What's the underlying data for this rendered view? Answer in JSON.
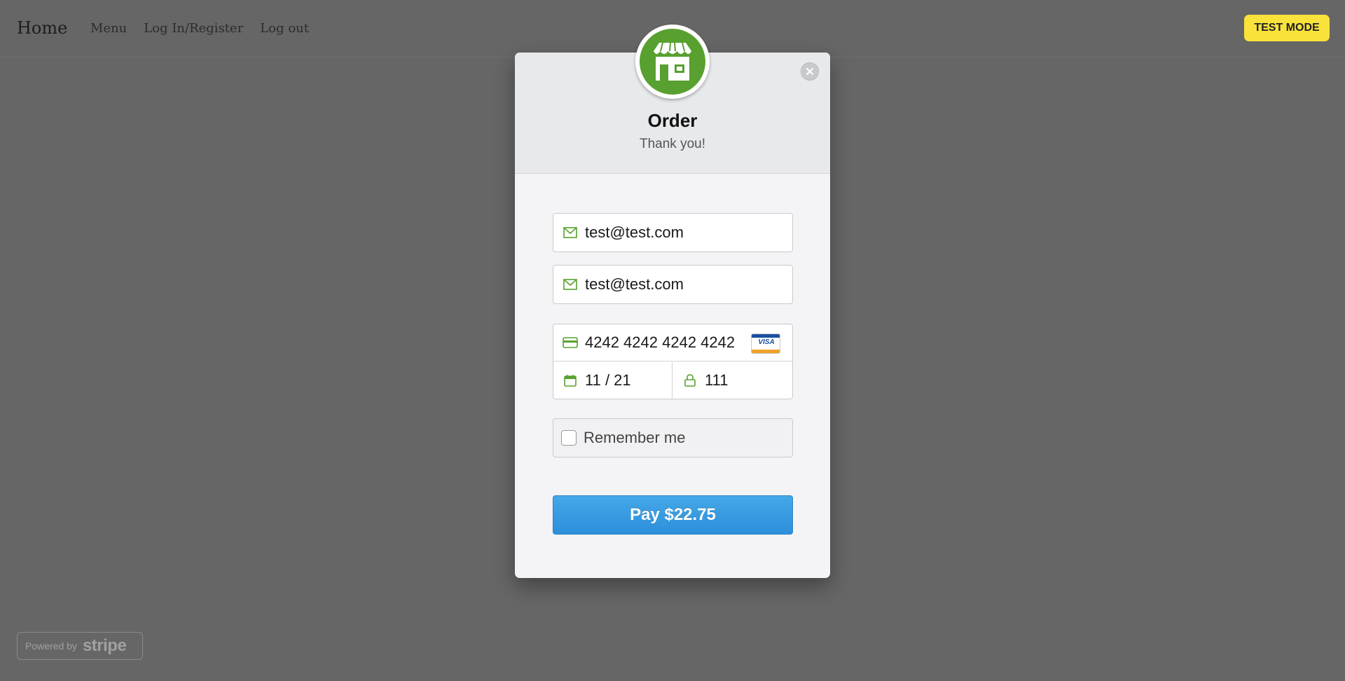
{
  "nav": {
    "home": "Home",
    "links": [
      "Menu",
      "Log In/Register",
      "Log out"
    ],
    "badge": "TEST MODE"
  },
  "modal": {
    "logo_icon": "storefront-icon",
    "title": "Order",
    "subtitle": "Thank you!",
    "email_1": "test@test.com",
    "email_2": "test@test.com",
    "card_number": "4242 4242 4242 4242",
    "card_brand": "VISA",
    "expiry": "11 / 21",
    "cvc": "111",
    "remember_label": "Remember me",
    "remember_checked": false,
    "pay_label": "Pay $22.75"
  },
  "footer": {
    "powered_by": "Powered by",
    "brand": "stripe"
  },
  "colors": {
    "accent_green": "#58a02f",
    "pay_blue": "#2d8fdb",
    "test_badge": "#f9e23a",
    "backdrop": "#666666"
  }
}
